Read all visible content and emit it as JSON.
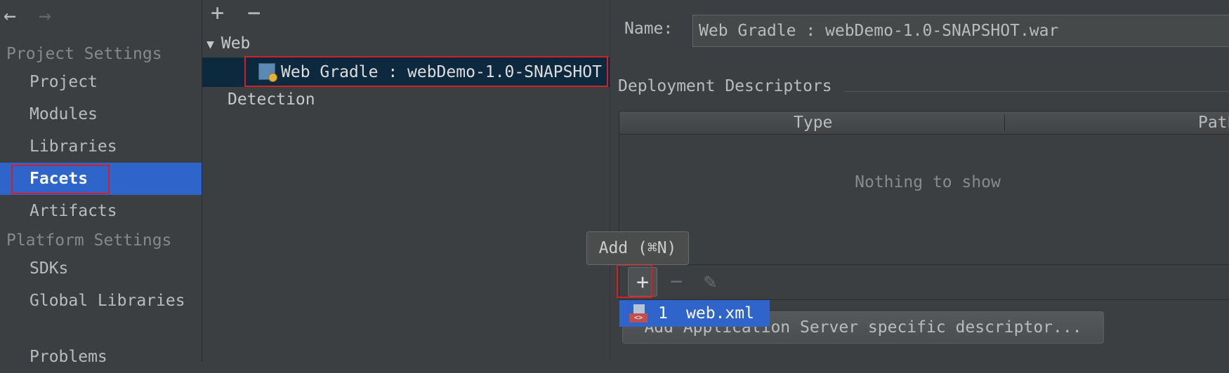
{
  "sidebar": {
    "back": "←",
    "forward": "→",
    "project_settings": "Project Settings",
    "platform_settings": "Platform Settings",
    "items_project": [
      "Project",
      "Modules",
      "Libraries",
      "Facets",
      "Artifacts"
    ],
    "items_platform": [
      "SDKs",
      "Global Libraries"
    ],
    "problems": "Problems",
    "selected": "Facets"
  },
  "tree": {
    "add": "+",
    "remove": "−",
    "web_node": "Web",
    "web_arrow": "▼",
    "facet_node": "Web Gradle : webDemo-1.0-SNAPSHOT",
    "detection": "Detection"
  },
  "detail": {
    "name_label": "Name:",
    "name_value": "Web Gradle : webDemo-1.0-SNAPSHOT.war",
    "group_title": "Deployment Descriptors",
    "columns": [
      "Type",
      "Path"
    ],
    "empty_text": "Nothing to show",
    "add_icon": "+",
    "remove_icon": "−",
    "edit_icon": "✎",
    "server_button": "Add Application Server specific descriptor..."
  },
  "tooltip": {
    "text": "Add (⌘N)"
  },
  "popup": {
    "number": "1",
    "label": "web.xml"
  },
  "colors": {
    "background": "#3c3f41",
    "selection": "#2f65ca",
    "tree_selection": "#0d293e",
    "highlight": "#d0202a"
  }
}
